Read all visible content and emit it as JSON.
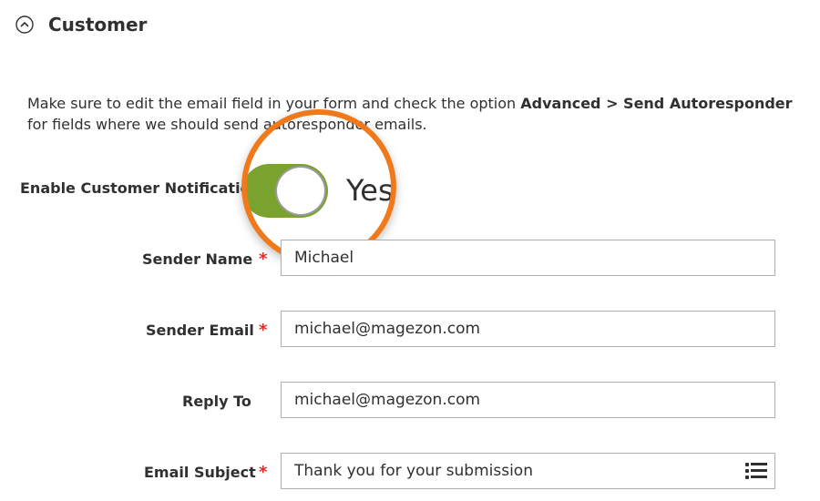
{
  "section": {
    "title": "Customer"
  },
  "note": {
    "prefix": "Make sure to edit the email field in your form and check the option ",
    "strong": "Advanced > Send Autoresponder",
    "suffix": " for fields where we should send autoresponder emails."
  },
  "enable_notification": {
    "label": "Enable Customer Notification",
    "value": "Yes",
    "enabled": true
  },
  "fields": {
    "sender_name": {
      "label": "Sender Name",
      "value": "Michael",
      "required": "*"
    },
    "sender_email": {
      "label": "Sender Email",
      "value": "michael@magezon.com",
      "required": "*"
    },
    "reply_to": {
      "label": "Reply To",
      "value": "michael@magezon.com"
    },
    "email_subject": {
      "label": "Email Subject",
      "value": "Thank you for your submission",
      "required": "*"
    }
  },
  "colors": {
    "toggle_on": "#79a22e",
    "required": "#e02b27",
    "highlight": "#f07a1b"
  },
  "icons": {
    "collapse": "chevron-up-circle-icon",
    "variables": "list-icon"
  }
}
